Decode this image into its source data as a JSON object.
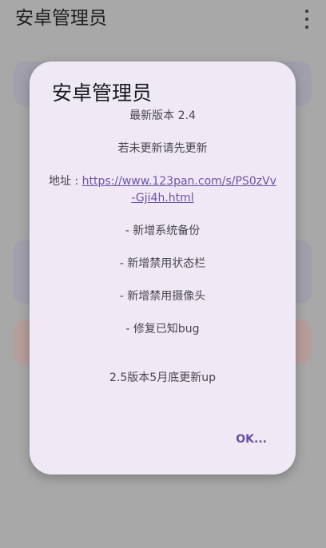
{
  "app": {
    "title": "安卓管理员"
  },
  "dialog": {
    "title": "安卓管理员",
    "version_line": "最新版本 2.4",
    "update_prompt": "若未更新请先更新",
    "address_label": "地址 : ",
    "address_link_line1": "https://www.123pan.com/s/PS0zVv",
    "address_link_line2": "-Gji4h.html",
    "changes": [
      "- 新增系统备份",
      "- 新增禁用状态栏",
      "- 新增禁用摄像头",
      "- 修复已知bug"
    ],
    "next_version_note": "2.5版本5月底更新up",
    "ok_label": "OK..."
  },
  "icons": {
    "overflow_menu": "more-vertical-icon"
  }
}
